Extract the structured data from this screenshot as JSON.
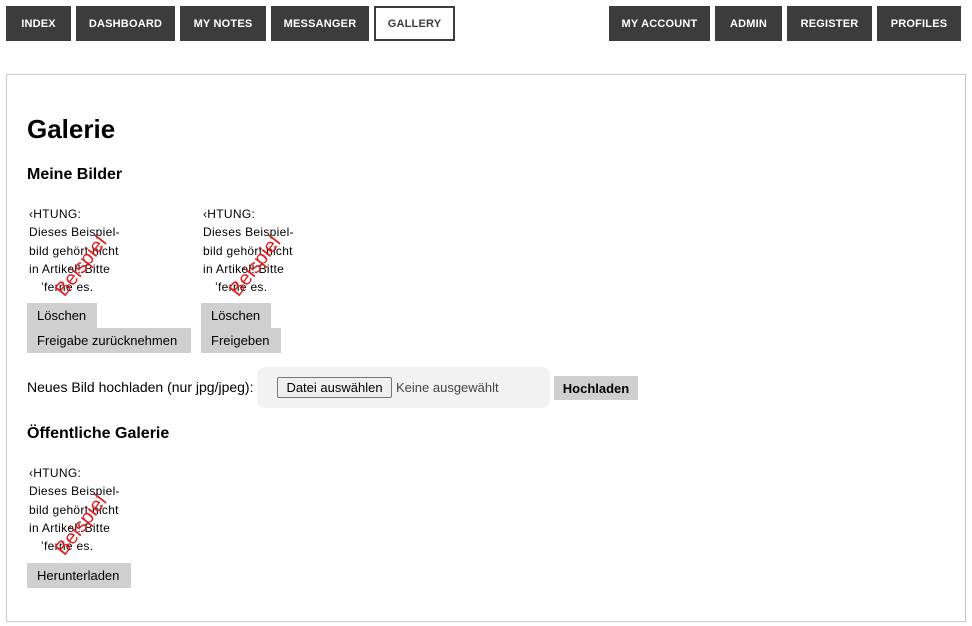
{
  "nav": {
    "left": [
      "INDEX",
      "DASHBOARD",
      "MY NOTES",
      "MESSANGER",
      "GALLERY"
    ],
    "right": [
      "MY ACCOUNT",
      "ADMIN",
      "REGISTER",
      "PROFILES"
    ],
    "active": "GALLERY"
  },
  "page": {
    "title": "Galerie",
    "my_images_heading": "Meine Bilder",
    "public_gallery_heading": "Öffentliche Galerie"
  },
  "placeholder_image": {
    "lines": [
      "‹HTUNG:",
      "Dieses Beispiel-",
      "bild gehört nicht",
      "in Artikel! Bitte",
      "’ferne es."
    ],
    "stamp": "Beispiel"
  },
  "my_images": [
    {
      "delete_label": "Löschen",
      "share_label": "Freigabe zurücknehmen"
    },
    {
      "delete_label": "Löschen",
      "share_label": "Freigeben"
    }
  ],
  "upload": {
    "label": "Neues Bild hochladen (nur jpg/jpeg):",
    "choose_label": "Datei auswählen",
    "status": "Keine ausgewählt",
    "submit_label": "Hochladen"
  },
  "public_images": [
    {
      "download_label": "Herunterladen"
    }
  ],
  "colors": {
    "nav_bg": "#3c3c3c",
    "button_bg": "#cfcfcf",
    "stamp_red": "#e02020"
  }
}
